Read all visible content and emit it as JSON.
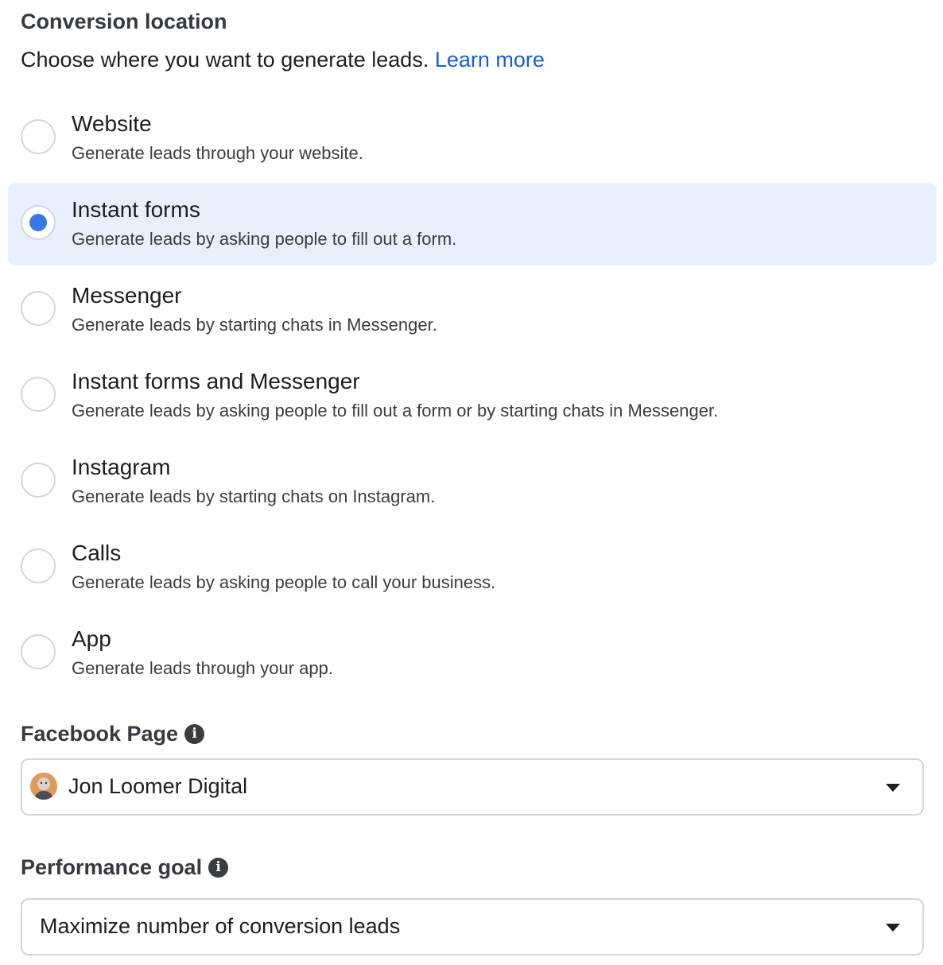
{
  "conversion_location": {
    "title": "Conversion location",
    "description": "Choose where you want to generate leads.",
    "learn_more": "Learn more",
    "options": [
      {
        "label": "Website",
        "description": "Generate leads through your website.",
        "selected": false
      },
      {
        "label": "Instant forms",
        "description": "Generate leads by asking people to fill out a form.",
        "selected": true
      },
      {
        "label": "Messenger",
        "description": "Generate leads by starting chats in Messenger.",
        "selected": false
      },
      {
        "label": "Instant forms and Messenger",
        "description": "Generate leads by asking people to fill out a form or by starting chats in Messenger.",
        "selected": false
      },
      {
        "label": "Instagram",
        "description": "Generate leads by starting chats on Instagram.",
        "selected": false
      },
      {
        "label": "Calls",
        "description": "Generate leads by asking people to call your business.",
        "selected": false
      },
      {
        "label": "App",
        "description": "Generate leads through your app.",
        "selected": false
      }
    ]
  },
  "facebook_page": {
    "label": "Facebook Page",
    "info_icon": "info-icon",
    "value": "Jon Loomer Digital",
    "avatar_icon": "profile-avatar"
  },
  "performance_goal": {
    "label": "Performance goal",
    "info_icon": "info-icon",
    "value": "Maximize number of conversion leads"
  },
  "colors": {
    "accent": "#3a78e7",
    "selected_bg": "#e8f0fd",
    "link": "#1b5fcf"
  }
}
